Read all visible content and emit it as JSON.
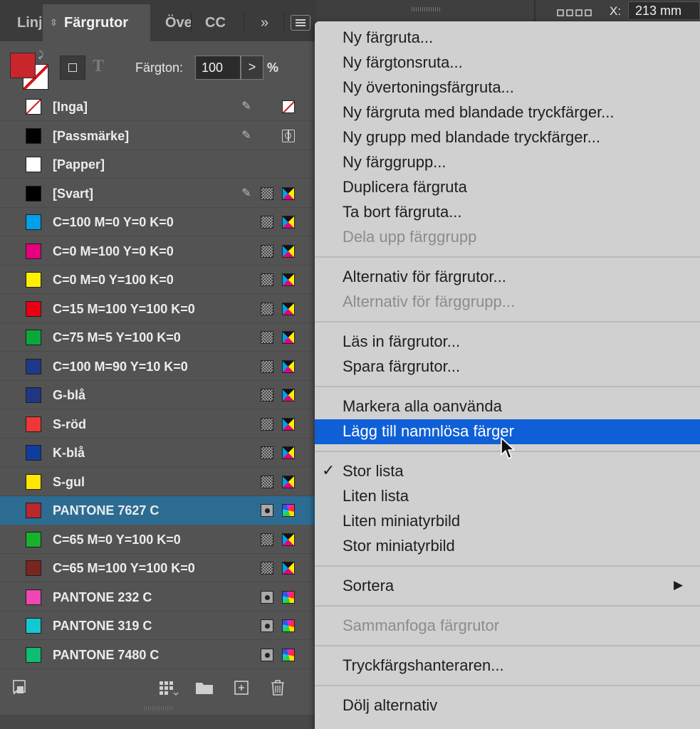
{
  "background": {
    "coord_label": "X:",
    "coord_value": "213 mm"
  },
  "panel": {
    "tabs": [
      {
        "label": "Linj"
      },
      {
        "label": "Färgrutor"
      },
      {
        "label": "Över"
      },
      {
        "label": "CC"
      }
    ],
    "overflow_glyph": "»",
    "tint": {
      "label": "Färgton:",
      "value": "100",
      "stepper_glyph": ">",
      "unit": "%"
    },
    "swatches": [
      {
        "name": "[Inga]",
        "color": "#ffffff",
        "kind": "none",
        "locked": true,
        "mode": "none"
      },
      {
        "name": "[Passmärke]",
        "color": "#000000",
        "locked": true,
        "mode": "registration"
      },
      {
        "name": "[Papper]",
        "color": "#ffffff",
        "mode": ""
      },
      {
        "name": "[Svart]",
        "color": "#000000",
        "locked": true,
        "type": "process",
        "mode": "cmyk"
      },
      {
        "name": "C=100 M=0 Y=0 K=0",
        "color": "#00a0e9",
        "type": "process",
        "mode": "cmyk"
      },
      {
        "name": "C=0 M=100 Y=0 K=0",
        "color": "#e5007d",
        "type": "process",
        "mode": "cmyk"
      },
      {
        "name": "C=0 M=0 Y=100 K=0",
        "color": "#fff000",
        "type": "process",
        "mode": "cmyk"
      },
      {
        "name": "C=15 M=100 Y=100 K=0",
        "color": "#e60012",
        "type": "process",
        "mode": "cmyk"
      },
      {
        "name": "C=75 M=5 Y=100 K=0",
        "color": "#0aa83a",
        "type": "process",
        "mode": "cmyk"
      },
      {
        "name": "C=100 M=90 Y=10 K=0",
        "color": "#1d3a8a",
        "type": "process",
        "mode": "cmyk"
      },
      {
        "name": "G-blå",
        "color": "#1f3783",
        "type": "process",
        "mode": "cmyk"
      },
      {
        "name": "S-röd",
        "color": "#ef3737",
        "type": "process",
        "mode": "cmyk"
      },
      {
        "name": "K-blå",
        "color": "#0f3d9e",
        "type": "process",
        "mode": "cmyk"
      },
      {
        "name": "S-gul",
        "color": "#ffe600",
        "type": "process",
        "mode": "cmyk"
      },
      {
        "name": "PANTONE 7627 C",
        "color": "#b8282c",
        "type": "spot",
        "mode": "spot",
        "selected": true
      },
      {
        "name": "C=65 M=0 Y=100 K=0",
        "color": "#16b22c",
        "type": "process",
        "mode": "cmyk"
      },
      {
        "name": "C=65 M=100 Y=100 K=0",
        "color": "#7b2520",
        "type": "process",
        "mode": "cmyk"
      },
      {
        "name": "PANTONE 232 C",
        "color": "#ef46b3",
        "type": "spot",
        "mode": "spot"
      },
      {
        "name": "PANTONE 319 C",
        "color": "#13c9d1",
        "type": "spot",
        "mode": "spot"
      },
      {
        "name": "PANTONE 7480 C",
        "color": "#0dbd72",
        "type": "spot",
        "mode": "spot"
      }
    ],
    "footer_buttons": [
      "load-swatches-icon",
      "show-swatch-kinds-icon",
      "new-group-folder-icon",
      "new-swatch-icon",
      "trash-icon"
    ],
    "fill_color": "#c8262b",
    "selection_color": "#2c6c93"
  },
  "menu": {
    "groups": [
      {
        "items": [
          {
            "label": "Ny färgruta..."
          },
          {
            "label": "Ny färgtonsruta..."
          },
          {
            "label": "Ny övertoningsfärgruta..."
          },
          {
            "label": "Ny färgruta med blandade tryckfärger..."
          },
          {
            "label": "Ny grupp med blandade tryckfärger..."
          },
          {
            "label": "Ny färggrupp..."
          },
          {
            "label": "Duplicera färgruta"
          },
          {
            "label": "Ta bort färgruta..."
          },
          {
            "label": "Dela upp färggrupp",
            "disabled": true
          }
        ]
      },
      {
        "items": [
          {
            "label": "Alternativ för färgrutor..."
          },
          {
            "label": "Alternativ för färggrupp...",
            "disabled": true
          }
        ]
      },
      {
        "items": [
          {
            "label": "Läs in färgrutor..."
          },
          {
            "label": "Spara färgrutor..."
          }
        ]
      },
      {
        "items": [
          {
            "label": "Markera alla oanvända"
          },
          {
            "label": "Lägg till namnlösa färger",
            "highlighted": true
          }
        ]
      },
      {
        "items": [
          {
            "label": "Stor lista",
            "checked": true
          },
          {
            "label": "Liten lista"
          },
          {
            "label": "Liten miniatyrbild"
          },
          {
            "label": "Stor miniatyrbild"
          }
        ]
      },
      {
        "items": [
          {
            "label": "Sortera",
            "submenu": true
          }
        ]
      },
      {
        "items": [
          {
            "label": "Sammanfoga färgrutor",
            "disabled": true
          }
        ]
      },
      {
        "items": [
          {
            "label": "Tryckfärgshanteraren..."
          }
        ]
      },
      {
        "items": [
          {
            "label": "Dölj alternativ"
          }
        ]
      }
    ],
    "check_glyph": "✓",
    "submenu_glyph": "▶",
    "highlight_color": "#0f5fd7"
  }
}
